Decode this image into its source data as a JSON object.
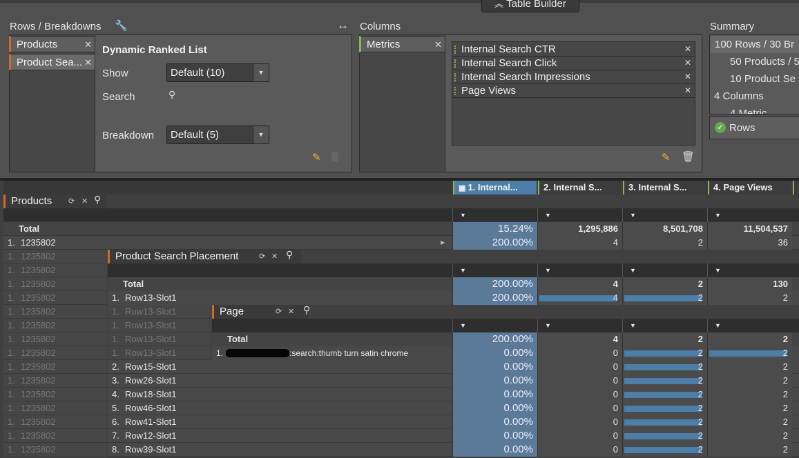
{
  "builder": {
    "toggle_label": "Table Builder",
    "rows_title": "Rows / Breakdowns",
    "rows_chips": [
      "Products",
      "Product Sea..."
    ],
    "list_title": "Dynamic Ranked List",
    "show_label": "Show",
    "show_value": "Default (10)",
    "search_label": "Search",
    "breakdown_label": "Breakdown",
    "breakdown_value": "Default (5)",
    "columns_title": "Columns",
    "columns_chip": "Metrics",
    "metrics": [
      "Internal Search CTR",
      "Internal Search Click",
      "Internal Search Impressions",
      "Page Views"
    ],
    "summary_title": "Summary",
    "summary_lines": [
      "100 Rows / 30 Br",
      "50 Products / 5",
      "10 Product Se",
      "4 Columns",
      "4 Metric"
    ],
    "summary_button": "Rows"
  },
  "table": {
    "columns": [
      "1. Internal...",
      "2. Internal S...",
      "3. Internal S...",
      "4. Page Views"
    ],
    "products_breakdown": "Products",
    "placement_breakdown": "Product Search Placement",
    "page_breakdown": "Page",
    "total_label": "Total",
    "totals": [
      "15.24%",
      "1,295,886",
      "8,501,708",
      "11,504,537"
    ],
    "product_row": {
      "rank": "1.",
      "name": "1235802",
      "values": [
        "200.00%",
        "4",
        "2",
        "36"
      ]
    },
    "placement_total": [
      "200.00%",
      "4",
      "2",
      "130"
    ],
    "placement_first": {
      "rank": "1.",
      "name": "Row13-Slot1",
      "values": [
        "200.00%",
        "4",
        "2",
        "2"
      ]
    },
    "page_total": [
      "200.00%",
      "4",
      "2",
      "2"
    ],
    "page_first": {
      "rank": "1.",
      "name": ":search:thumb turn satin chrome",
      "values": [
        "0.00%",
        "0",
        "2",
        "2"
      ]
    },
    "placement_rows": [
      {
        "rank": "2.",
        "name": "Row15-Slot1",
        "values": [
          "0.00%",
          "0",
          "2",
          "2"
        ]
      },
      {
        "rank": "3.",
        "name": "Row26-Slot1",
        "values": [
          "0.00%",
          "0",
          "2",
          "2"
        ]
      },
      {
        "rank": "4.",
        "name": "Row18-Slot1",
        "values": [
          "0.00%",
          "0",
          "2",
          "2"
        ]
      },
      {
        "rank": "5.",
        "name": "Row46-Slot1",
        "values": [
          "0.00%",
          "0",
          "2",
          "2"
        ]
      },
      {
        "rank": "6.",
        "name": "Row41-Slot1",
        "values": [
          "0.00%",
          "0",
          "2",
          "2"
        ]
      },
      {
        "rank": "7.",
        "name": "Row12-Slot1",
        "values": [
          "0.00%",
          "0",
          "2",
          "2"
        ]
      },
      {
        "rank": "8.",
        "name": "Row39-Slot1",
        "values": [
          "0.00%",
          "0",
          "2",
          "2"
        ]
      }
    ],
    "ghost_rank": "1.",
    "ghost_product": "1235802",
    "ghost_placement": "Row13-Slot1"
  }
}
